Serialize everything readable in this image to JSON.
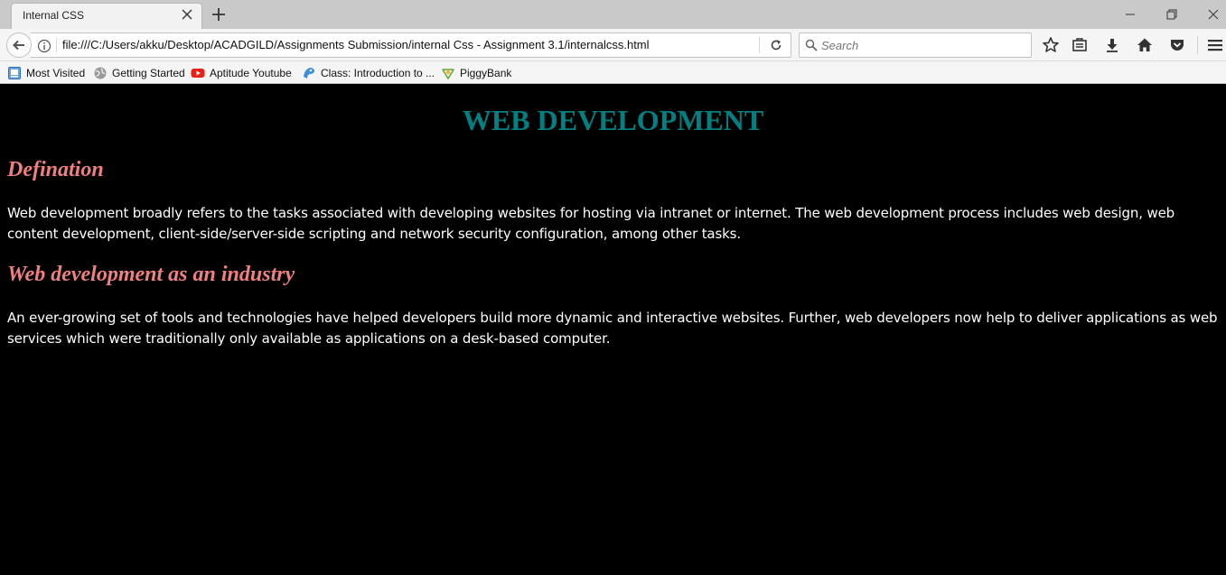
{
  "browser": {
    "tab_title": "Internal CSS",
    "url": "file:///C:/Users/akku/Desktop/ACADGILD/Assignments Submission/internal Css - Assignment 3.1/internalcss.html",
    "search_placeholder": "Search",
    "bookmarks": [
      {
        "label": "Most Visited",
        "icon": "most-visited-icon"
      },
      {
        "label": "Getting Started",
        "icon": "globe-icon"
      },
      {
        "label": "Aptitude Youtube",
        "icon": "youtube-icon"
      },
      {
        "label": "Class: Introduction to ...",
        "icon": "class-icon"
      },
      {
        "label": "PiggyBank",
        "icon": "piggybank-icon"
      }
    ],
    "toolbar_icons": [
      "star-icon",
      "reading-list-icon",
      "download-icon",
      "home-icon",
      "pocket-icon",
      "menu-icon"
    ]
  },
  "page": {
    "title": "WEB DEVELOPMENT",
    "sections": [
      {
        "heading": "Defination",
        "text": "Web development broadly refers to the tasks associated with developing websites for hosting via intranet or internet. The web development process includes web design, web content development, client-side/server-side scripting and network security configuration, among other tasks."
      },
      {
        "heading": "Web development as an industry",
        "text": "An ever-growing set of tools and technologies have helped developers build more dynamic and interactive websites. Further, web developers now help to deliver applications as web services which were traditionally only available as applications on a desk-based computer."
      }
    ]
  },
  "colors": {
    "page_background": "#000000",
    "title_color": "#008080",
    "heading_color": "#f08080",
    "text_color": "#ffffff"
  }
}
